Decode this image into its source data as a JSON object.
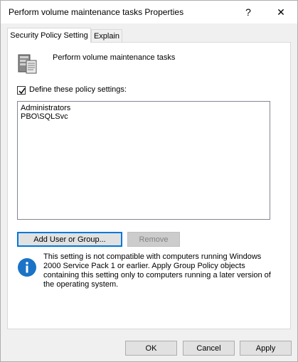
{
  "window": {
    "title": "Perform volume maintenance tasks Properties",
    "help_button": "?",
    "close_button": "✕"
  },
  "tabs": [
    {
      "label": "Security Policy Setting",
      "active": true
    },
    {
      "label": "Explain",
      "active": false
    }
  ],
  "policy": {
    "name": "Perform volume maintenance tasks",
    "icon": "server-icon"
  },
  "define": {
    "label": "Define these policy settings:",
    "checked": true
  },
  "list": {
    "items": [
      "Administrators",
      "PBO\\SQLSvc"
    ]
  },
  "buttons": {
    "add_user_or_group": "Add User or Group...",
    "remove": "Remove"
  },
  "info": {
    "icon": "info-icon",
    "text": "This setting is not compatible with computers running Windows 2000 Service Pack 1 or earlier.  Apply Group Policy objects containing this setting only to computers running a later version of the operating system."
  },
  "footer": {
    "ok": "OK",
    "cancel": "Cancel",
    "apply": "Apply"
  },
  "colors": {
    "focus_border": "#0078d7",
    "info_blue": "#1a73c7",
    "dialog_bg": "#f0f0f0"
  }
}
